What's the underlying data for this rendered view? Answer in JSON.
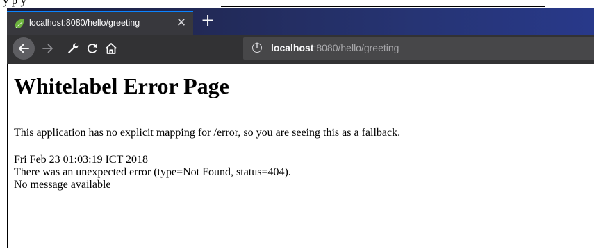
{
  "top_fragment": {
    "text": "y      p         y"
  },
  "tab": {
    "title": "localhost:8080/hello/greeting",
    "close_glyph": "✕",
    "new_tab_glyph": "+"
  },
  "urlbar": {
    "host": "localhost",
    "rest": ":8080/hello/greeting"
  },
  "page": {
    "heading": "Whitelabel Error Page",
    "mapping_message": "This application has no explicit mapping for /error, so you are seeing this as a fallback.",
    "timestamp": "Fri Feb 23 01:03:19 ICT 2018",
    "error_line": "There was an unexpected error (type=Not Found, status=404).",
    "message_line": "No message available"
  },
  "colors": {
    "tab_active": "#38383d",
    "navbar": "#323234",
    "urlbar": "#474749",
    "favicon": "#6db33f"
  }
}
